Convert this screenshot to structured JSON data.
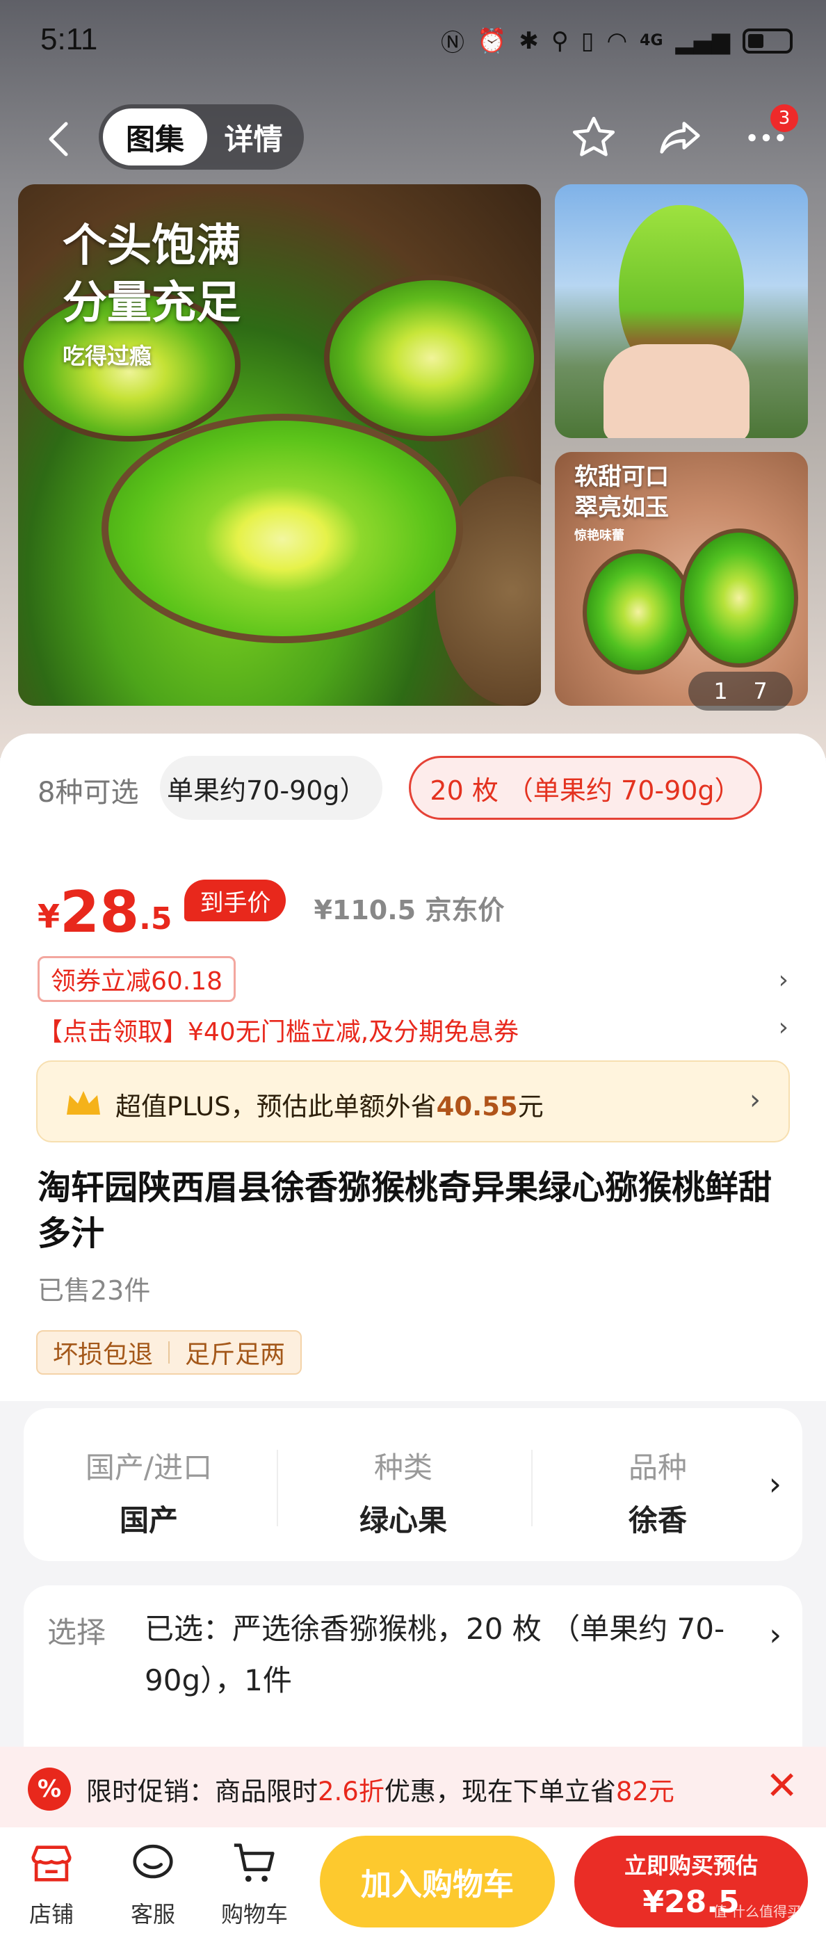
{
  "status_bar": {
    "time": "5:11",
    "network": "4G"
  },
  "nav": {
    "tabs": [
      {
        "label": "图集",
        "active": true
      },
      {
        "label": "详情",
        "active": false
      }
    ],
    "more_badge": "3"
  },
  "gallery": {
    "main_headline_1": "个头饱满",
    "main_headline_2": "分量充足",
    "main_sub": "吃得过瘾",
    "side2_line1": "软甜可口",
    "side2_line2": "翠亮如玉",
    "side2_small": "惊艳味蕾",
    "counter_current": "1",
    "counter_total": "7"
  },
  "spec": {
    "count_text": "8种可选",
    "option1": "单果约70-90g）",
    "option2": "20 枚 （单果约 70-90g）"
  },
  "price": {
    "symbol": "¥",
    "integer": "28",
    "decimal": ".5",
    "tag": "到手价",
    "original": "¥110.5 京东价"
  },
  "coupon": {
    "label": "领券立减60.18",
    "promo": "【点击领取】¥40无门槛立减,及分期免息券"
  },
  "plus": {
    "text_prefix": "超值PLUS，预估此单额外省",
    "amount": "40.55",
    "text_suffix": "元"
  },
  "product": {
    "title": "淘轩园陕西眉县徐香猕猴桃奇异果绿心猕猴桃鲜甜多汁",
    "sold": "已售23件",
    "tags": [
      "坏损包退",
      "足斤足两"
    ]
  },
  "attributes": [
    {
      "label": "国产/进口",
      "value": "国产"
    },
    {
      "label": "种类",
      "value": "绿心果"
    },
    {
      "label": "品种",
      "value": "徐香"
    }
  ],
  "selection": {
    "label": "选择",
    "value": "已选：严选徐香猕猴桃，20 枚 （单果约 70-90g），1件"
  },
  "flash_sale": {
    "icon": "%",
    "text_a": "限时促销：商品限时",
    "discount": "2.6折",
    "text_b": "优惠，现在下单立省",
    "saving": "82元"
  },
  "bottom_bar": {
    "store": "店铺",
    "service": "客服",
    "cart": "购物车",
    "add_to_cart": "加入购物车",
    "buy_line1": "立即购买预估",
    "buy_line2": "¥28.5",
    "watermark": "值 什么值得买"
  },
  "colors": {
    "accent_red": "#e8281c",
    "cart_yellow": "#fdc92e",
    "plus_gold": "#b0541a"
  }
}
